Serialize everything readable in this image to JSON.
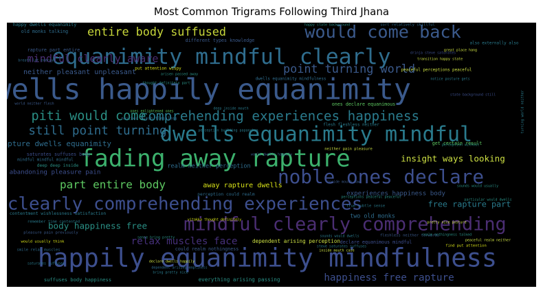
{
  "chart_data": {
    "type": "wordcloud",
    "title": "Most Common Trigrams Following Third Jhana",
    "background": "#000000",
    "words": [
      {
        "text": "dwells happily equanimity",
        "weight": 100,
        "color": "#3b5a8c"
      },
      {
        "text": "happily equanimity mindfulness",
        "weight": 88,
        "color": "#3d4f8e"
      },
      {
        "text": "fading away rapture",
        "weight": 82,
        "color": "#3cb16d"
      },
      {
        "text": "equanimity mindful clearly",
        "weight": 75,
        "color": "#2f6d8e"
      },
      {
        "text": "dwells equanimity mindful",
        "weight": 72,
        "color": "#2a7b8d"
      },
      {
        "text": "noble ones declare",
        "weight": 66,
        "color": "#3d4f8e"
      },
      {
        "text": "mindful clearly comprehending",
        "weight": 64,
        "color": "#4b2e73"
      },
      {
        "text": "clearly comprehending experiences",
        "weight": 62,
        "color": "#3d4f8e"
      },
      {
        "text": "would come back",
        "weight": 60,
        "color": "#3b5a8c"
      },
      {
        "text": "comprehending experiences happiness",
        "weight": 46,
        "color": "#2a7b8d"
      },
      {
        "text": "piti would come",
        "weight": 44,
        "color": "#2a8f85"
      },
      {
        "text": "still point turning",
        "weight": 42,
        "color": "#2f6d8e"
      },
      {
        "text": "point turning world",
        "weight": 40,
        "color": "#3b5a8c"
      },
      {
        "text": "entire body suffused",
        "weight": 40,
        "color": "#c7d63a"
      },
      {
        "text": "part entire body",
        "weight": 38,
        "color": "#5ec962"
      },
      {
        "text": "mindful clearly aware",
        "weight": 36,
        "color": "#4b2e73"
      },
      {
        "text": "happiness free rapture",
        "weight": 34,
        "color": "#3d4f8e"
      },
      {
        "text": "relax muscles face",
        "weight": 34,
        "color": "#46307a"
      },
      {
        "text": "insight ways looking",
        "weight": 30,
        "color": "#cde043"
      },
      {
        "text": "body happiness free",
        "weight": 30,
        "color": "#2a8f85"
      },
      {
        "text": "free rapture part",
        "weight": 28,
        "color": "#2a7b8d"
      },
      {
        "text": "rapture dwells equanimity",
        "weight": 26,
        "color": "#2f6d8e"
      },
      {
        "text": "neither pleasant unpleasant",
        "weight": 24,
        "color": "#3b5a8c"
      },
      {
        "text": "away rapture dwells",
        "weight": 24,
        "color": "#d8e219"
      },
      {
        "text": "abandoning pleasure pain",
        "weight": 22,
        "color": "#3d4f8e"
      },
      {
        "text": "experiences happiness body",
        "weight": 22,
        "color": "#3b5a8c"
      },
      {
        "text": "realm neither perception",
        "weight": 20,
        "color": "#2f6d8e"
      },
      {
        "text": "two old monks",
        "weight": 20,
        "color": "#2f6d8e"
      },
      {
        "text": "dependent arising perception",
        "weight": 18,
        "color": "#cde043"
      },
      {
        "text": "everything arising passing",
        "weight": 18,
        "color": "#2a8f85"
      },
      {
        "text": "suffuses body happiness",
        "weight": 17,
        "color": "#2a8f85"
      },
      {
        "text": "could realm nothingness",
        "weight": 16,
        "color": "#3b5a8c"
      },
      {
        "text": "rapture part entire",
        "weight": 16,
        "color": "#3b5a8c"
      },
      {
        "text": "saturates suffuses body",
        "weight": 16,
        "color": "#3d4f8e"
      },
      {
        "text": "different types knowledge",
        "weight": 16,
        "color": "#3b5a8c"
      },
      {
        "text": "old monks talking",
        "weight": 16,
        "color": "#2f6d8e"
      },
      {
        "text": "happy dwells equanimity",
        "weight": 16,
        "color": "#2a7b8d"
      },
      {
        "text": "ones declare equanimous",
        "weight": 16,
        "color": "#5ec962"
      },
      {
        "text": "get certain result",
        "weight": 16,
        "color": "#5ec962"
      },
      {
        "text": "declare equanimous mindful",
        "weight": 16,
        "color": "#3d4f8e"
      },
      {
        "text": "perception could realm",
        "weight": 15,
        "color": "#2f6d8e"
      },
      {
        "text": "contentment wishlessness satisfaction",
        "weight": 15,
        "color": "#2a7b8d"
      },
      {
        "text": "deep deep inside",
        "weight": 15,
        "color": "#2a8f85"
      },
      {
        "text": "mindful mindful mindful",
        "weight": 14,
        "color": "#2f6d8e"
      },
      {
        "text": "peaceful perceptions peaceful",
        "weight": 14,
        "color": "#cde043"
      },
      {
        "text": "put attention wispy",
        "weight": 14,
        "color": "#d8e219"
      },
      {
        "text": "flesh fleshless neither",
        "weight": 14,
        "color": "#2a7b8d"
      },
      {
        "text": "neither flesh fleshless",
        "weight": 14,
        "color": "#2f6d8e"
      },
      {
        "text": "dwells equanimity mindfulness",
        "weight": 14,
        "color": "#2f6d8e"
      },
      {
        "text": "also externally also",
        "weight": 14,
        "color": "#2a7b8d"
      },
      {
        "text": "sort relatively skillful",
        "weight": 13,
        "color": "#2f6d8e"
      },
      {
        "text": "remember time contented",
        "weight": 13,
        "color": "#2a7b8d"
      },
      {
        "text": "pleasure pain previously",
        "weight": 13,
        "color": "#3b5a8c"
      },
      {
        "text": "would usually think",
        "weight": 13,
        "color": "#d8e219"
      },
      {
        "text": "smile relax muscles",
        "weight": 13,
        "color": "#2f6d8e"
      },
      {
        "text": "fleshless neither torwards",
        "weight": 13,
        "color": "#3b5a8c"
      },
      {
        "text": "find put attention",
        "weight": 13,
        "color": "#d8e219"
      },
      {
        "text": "true subtle sense",
        "weight": 13,
        "color": "#2a7b8d"
      },
      {
        "text": "neither pain pleasure",
        "weight": 13,
        "color": "#cde043"
      },
      {
        "text": "breath let energy",
        "weight": 12,
        "color": "#2f6d8e"
      },
      {
        "text": "world neither flesh",
        "weight": 12,
        "color": "#3b5a8c"
      },
      {
        "text": "ones enlightened ones",
        "weight": 12,
        "color": "#5ec962"
      },
      {
        "text": "dependent arising emptiness",
        "weight": 12,
        "color": "#2f6d8e"
      },
      {
        "text": "arisen passed away",
        "weight": 12,
        "color": "#2a8f85"
      },
      {
        "text": "thought definitely part",
        "weight": 11,
        "color": "#2a8f85"
      },
      {
        "text": "happy state background",
        "weight": 11,
        "color": "#2a8f85"
      },
      {
        "text": "great place hang",
        "weight": 11,
        "color": "#cde043"
      },
      {
        "text": "transition happy state",
        "weight": 11,
        "color": "#cde043"
      },
      {
        "text": "notice posture gets",
        "weight": 11,
        "color": "#2a7b8d"
      },
      {
        "text": "drinja steve saturates",
        "weight": 11,
        "color": "#3d4f8e"
      },
      {
        "text": "turning world neither",
        "weight": 12,
        "color": "#2a7b8d"
      },
      {
        "text": "state background still",
        "weight": 11,
        "color": "#3d4f8e"
      },
      {
        "text": "particular would dwells",
        "weight": 11,
        "color": "#2a8f85"
      },
      {
        "text": "sounds would usually",
        "weight": 11,
        "color": "#2a8f85"
      },
      {
        "text": "perception without",
        "weight": 11,
        "color": "#2a8f85"
      },
      {
        "text": "pretty nice posture",
        "weight": 11,
        "color": "#cde043"
      },
      {
        "text": "inside mouth case",
        "weight": 11,
        "color": "#cde043"
      },
      {
        "text": "realm nothingness talked",
        "weight": 11,
        "color": "#2a8f85"
      },
      {
        "text": "vitakka thought definitely",
        "weight": 11,
        "color": "#d8e219"
      },
      {
        "text": "peaceful realm neither",
        "weight": 11,
        "color": "#cde043"
      },
      {
        "text": "perceptions peaceful peaceful",
        "weight": 11,
        "color": "#2a8f85"
      },
      {
        "text": "sounds would dwells",
        "weight": 11,
        "color": "#2a7b8d"
      },
      {
        "text": "declare dwells happily",
        "weight": 11,
        "color": "#cde043"
      },
      {
        "text": "bring pretty nice",
        "weight": 11,
        "color": "#2a7b8d"
      },
      {
        "text": "sense bring pretty",
        "weight": 10,
        "color": "#2a8f85"
      },
      {
        "text": "perception building papanchya",
        "weight": 10,
        "color": "#2a7b8d"
      },
      {
        "text": "deep inside mouth",
        "weight": 10,
        "color": "#2a7b8d"
      },
      {
        "text": "steve saturates suffuses",
        "weight": 10,
        "color": "#2a7b8d"
      },
      {
        "text": "inside mouth saw",
        "weight": 10,
        "color": "#3b5a8c"
      },
      {
        "text": "saturates suffuses",
        "weight": 10,
        "color": "#2a7b8d"
      },
      {
        "text": "would dwells happily",
        "weight": 10,
        "color": "#3b5a8c"
      }
    ]
  }
}
